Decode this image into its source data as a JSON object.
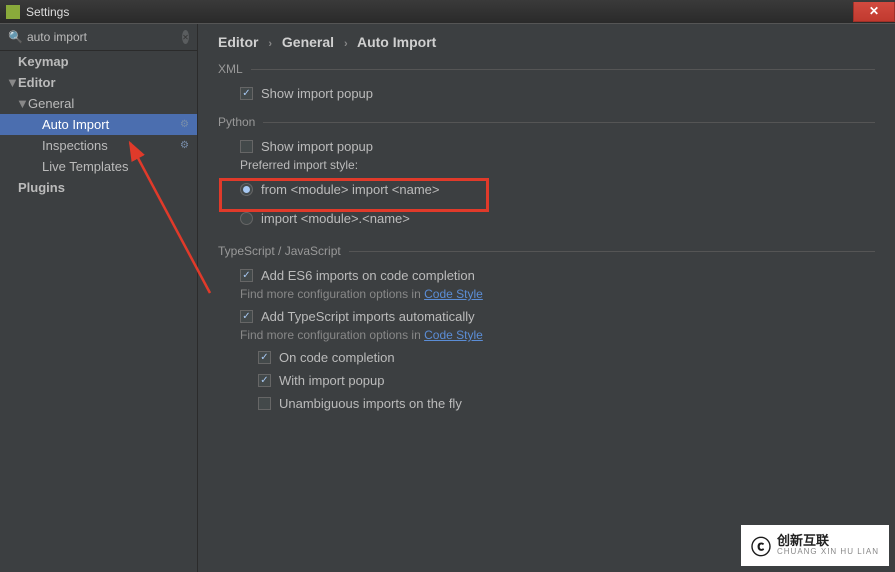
{
  "window": {
    "title": "Settings"
  },
  "search": {
    "value": "auto import"
  },
  "sidebar": {
    "items": [
      {
        "label": "Keymap",
        "bold": true,
        "indent": 18
      },
      {
        "label": "Editor",
        "bold": true,
        "arrow": "▼",
        "indent": 6
      },
      {
        "label": "General",
        "arrow": "▼",
        "indent": 16
      },
      {
        "label": "Auto Import",
        "indent": 42,
        "selected": true,
        "gear": true
      },
      {
        "label": "Inspections",
        "indent": 42,
        "gear": true
      },
      {
        "label": "Live Templates",
        "indent": 42
      },
      {
        "label": "Plugins",
        "bold": true,
        "indent": 18
      }
    ]
  },
  "breadcrumb": {
    "p0": "Editor",
    "p1": "General",
    "p2": "Auto Import"
  },
  "sections": {
    "xml": {
      "title": "XML",
      "show_import_popup": "Show import popup"
    },
    "python": {
      "title": "Python",
      "show_import_popup": "Show import popup",
      "preferred_style": "Preferred import style:",
      "opt1": "from <module> import <name>",
      "opt2": "import <module>.<name>"
    },
    "tsjs": {
      "title": "TypeScript / JavaScript",
      "es6": "Add ES6 imports on code completion",
      "hint1a": "Find more configuration options in ",
      "hint1b": "Code Style",
      "ts_auto": "Add TypeScript imports automatically",
      "hint2a": "Find more configuration options in ",
      "hint2b": "Code Style",
      "on_complete": "On code completion",
      "with_popup": "With import popup",
      "unambiguous": "Unambiguous imports on the fly"
    }
  },
  "watermark": {
    "cn": "创新互联",
    "sub": "CHUANG XIN HU LIAN"
  }
}
